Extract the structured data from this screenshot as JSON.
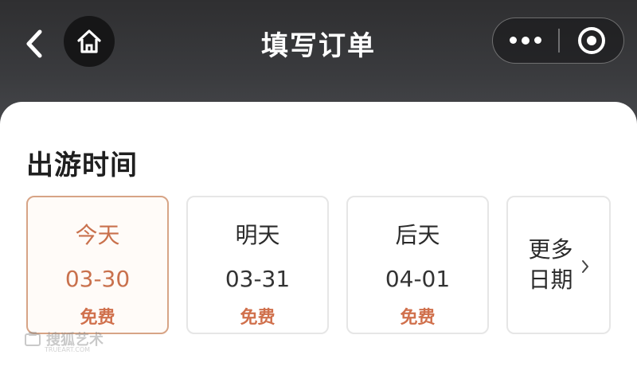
{
  "header": {
    "title": "填写订单",
    "back_icon": "chevron-left-icon",
    "home_icon": "home-icon",
    "more_icon": "more-dots-icon",
    "close_icon": "target-circle-icon"
  },
  "section": {
    "title": "出游时间"
  },
  "date_options": [
    {
      "day": "今天",
      "date": "03-30",
      "price": "免费",
      "selected": true
    },
    {
      "day": "明天",
      "date": "03-31",
      "price": "免费",
      "selected": false
    },
    {
      "day": "后天",
      "date": "04-01",
      "price": "免费",
      "selected": false
    }
  ],
  "more_dates": {
    "label": "更多日期",
    "icon": "chevron-right-icon"
  },
  "watermark": {
    "text": "搜狐艺术",
    "sub": "TRUEART.COM"
  },
  "colors": {
    "accent": "#c9714d",
    "price": "#d0704c",
    "selected_border": "#d7a486"
  }
}
